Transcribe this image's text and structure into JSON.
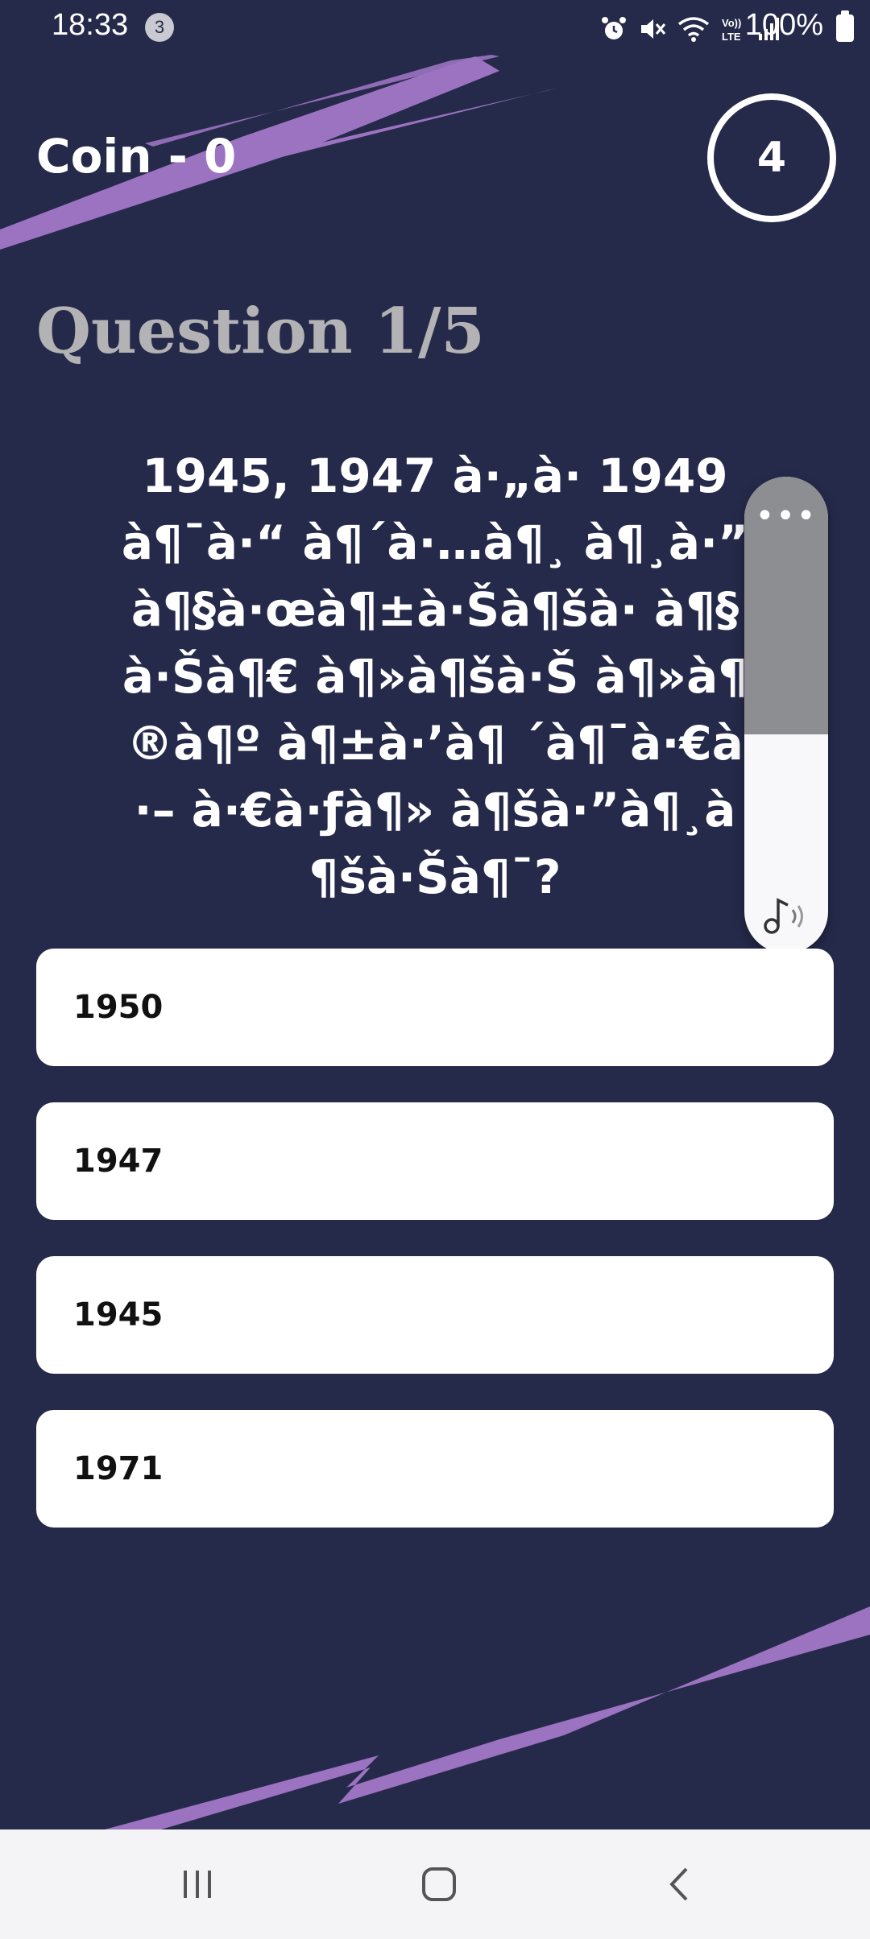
{
  "status_bar": {
    "time": "18:33",
    "notification_count": "3",
    "battery": "100%"
  },
  "header": {
    "coin_label": "Coin - 0",
    "timer": "4",
    "question_counter": "Question 1/5"
  },
  "question": {
    "text": "1945, 1947 à·„à·  1949 à¶¯à·“ à¶´à·…à¶¸ à¶¸à·” à¶§à·œà¶±à·Šà¶šà· à¶§à·Šà¶€ à¶»à¶šà·Š à¶»à¶®à¶º à¶±à·’à¶ ´à¶¯à·€à·– à·€à·ƒà¶» à¶šà·”à¶¸à¶šà·Šà¶¯?"
  },
  "answers": [
    {
      "label": "1950"
    },
    {
      "label": "1947"
    },
    {
      "label": "1945"
    },
    {
      "label": "1971"
    }
  ],
  "volume_panel": {
    "more_label": "•••",
    "level": 0.46
  },
  "colors": {
    "background": "#262a4a",
    "accent_streak": "#9b73c1",
    "counter_text": "#b3b3b5",
    "answer_bg": "#ffffff"
  },
  "icons": {
    "timer": "circle-outline",
    "volume": "music-note-icon",
    "nav": [
      "recents-icon",
      "home-icon",
      "back-icon"
    ]
  }
}
